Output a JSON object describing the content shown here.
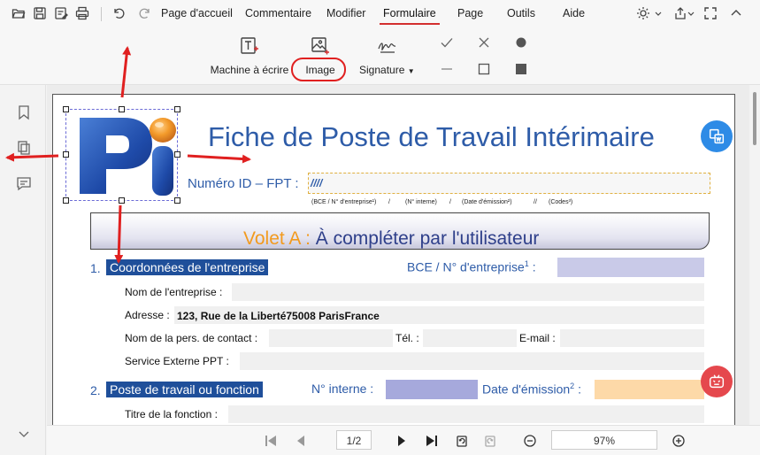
{
  "menu": {
    "items": [
      {
        "label": "Page d'accueil",
        "active": false
      },
      {
        "label": "Commentaire",
        "active": false
      },
      {
        "label": "Modifier",
        "active": false
      },
      {
        "label": "Formulaire",
        "active": true
      },
      {
        "label": "Page",
        "active": false
      },
      {
        "label": "Outils",
        "active": false
      },
      {
        "label": "Aide",
        "active": false
      }
    ]
  },
  "ribbon": {
    "typewriter_label": "Machine à écrire",
    "image_label": "Image",
    "signature_label": "Signature"
  },
  "document": {
    "title": "Fiche de Poste de Travail Intérimaire",
    "id_label": "Numéro ID – FPT :",
    "id_value": "////",
    "id_sub": {
      "bce": "(BCE / N° d'entreprise¹)",
      "sep1": "/",
      "interne": "(N° interne)",
      "sep2": "/",
      "date": "(Date d'émission²)",
      "sep3": "//",
      "codes": "(Codes³)"
    },
    "banner": {
      "volet": "Volet A :",
      "text": "À compléter par l'utilisateur"
    },
    "section1": {
      "number": "1.",
      "title": "Coordonnées de l'entreprise",
      "bce_label": "BCE / N° d'entreprise",
      "bce_sup": "1",
      "bce_colon": ":",
      "nom_label": "Nom de l'entreprise :",
      "adresse_label": "Adresse :",
      "adresse_value": "123, Rue de la Liberté75008 ParisFrance",
      "contact_label": "Nom de la pers. de contact :",
      "tel_label": "Tél. :",
      "email_label": "E-mail :",
      "service_label": "Service Externe PPT :"
    },
    "section2": {
      "number": "2.",
      "title": "Poste de travail ou fonction",
      "interne_label": "N° interne :",
      "date_label": "Date d'émission",
      "date_sup": "2",
      "date_colon": ":",
      "titre_label": "Titre de la fonction :"
    }
  },
  "bottom": {
    "page_indicator": "1/2",
    "zoom": "97%"
  },
  "colors": {
    "accent_red": "#d32f2f",
    "title_blue": "#2e5ca8",
    "header_navy": "#1f4f9a",
    "volet_orange": "#f29a1e"
  }
}
